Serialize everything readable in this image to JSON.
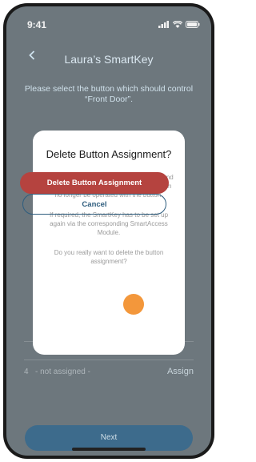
{
  "status": {
    "time": "9:41"
  },
  "header": {
    "back_icon": "chevron-left-icon",
    "title": "Laura’s SmartKey"
  },
  "instruction": "Please select the button which should control “Front Door”.",
  "rows": [
    {
      "number": "4",
      "label": "- not assigned -",
      "action": "Assign"
    }
  ],
  "next_label": "Next",
  "dialog": {
    "title": "Delete Button Assignment?",
    "paragraphs": [
      "The original button assignment is deleted and the corresponding SmartAccess Module can no longer be operated with the button.",
      "If required, the SmartKey has to be set up again via the corresponding SmartAccess Module.",
      "Do you really want to delete the button assignment?"
    ],
    "delete_label": "Delete Button Assignment",
    "cancel_label": "Cancel"
  },
  "colors": {
    "accent": "#2e5d7e",
    "danger": "#b5433f",
    "touch": "#f28c26"
  }
}
